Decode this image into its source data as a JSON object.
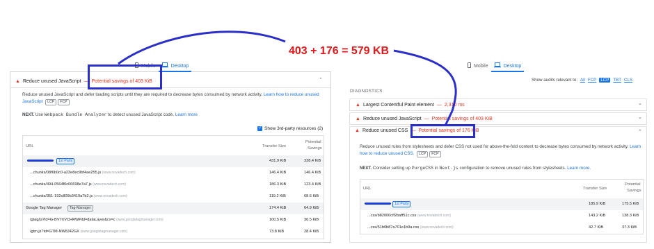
{
  "annotation": {
    "equation": "403 + 176 = 579 KB",
    "stroke_color": "#2b2fc9",
    "text_color": "#e0181b"
  },
  "left_panel": {
    "tabs": [
      {
        "label": "Mobile",
        "icon": "phone-icon"
      },
      {
        "label": "Desktop",
        "icon": "laptop-icon",
        "active": true
      }
    ],
    "audit": {
      "title": "Reduce unused JavaScript",
      "dash": "—",
      "savings": "Potential savings of 403 KiB",
      "description": "Reduce unused JavaScript and defer loading scripts until they are required to decrease bytes consumed by network activity.",
      "learn_link": "Learn how to reduce unused JavaScript",
      "chips": [
        "LCP",
        "FCP"
      ],
      "next_prefix": "Use",
      "next_code": "Webpack Bundle Analyzer",
      "next_suffix": "to detect unused JavaScript code.",
      "next_link": "Learn more",
      "show_3rd_party": "Show 3rd-party resources (2)"
    },
    "table": {
      "headers": {
        "url": "URL",
        "transfer": "Transfer Size",
        "savings_l1": "Potential",
        "savings_l2": "Savings"
      },
      "rows": [
        {
          "label": "",
          "badge": "1st Party",
          "transfer": "431.9 KiB",
          "savings": "338.4 KiB",
          "group": true,
          "redacted": true
        },
        {
          "label": "...chunks/08f6b0c0-a23e8ec9bf4ae255.js",
          "host": "(www.novadech.com)",
          "transfer": "146.4 KiB",
          "savings": "146.4 KiB"
        },
        {
          "label": "...chunks/494-0564f0c06698e7a7.js",
          "host": "(www.novadech.com)",
          "transfer": "186.3 KiB",
          "savings": "123.4 KiB"
        },
        {
          "label": "...chunks/351-192c809b3419a7b2.js",
          "host": "(www.novadech.com)",
          "transfer": "119.2 KiB",
          "savings": "68.6 KiB"
        },
        {
          "label": "Google Tag Manager",
          "badge": "Tag-Manager",
          "transfer": "174.4 KiB",
          "savings": "64.9 KiB",
          "group": true
        },
        {
          "label": "/gtag/js?id=G-BV7XVCHRWP&l=dataLayer&cx=c",
          "host": "(www.googletagmanager.com)",
          "transfer": "100.5 KiB",
          "savings": "36.5 KiB"
        },
        {
          "label": "/gtm.js?id=GTM-NW8J42GX",
          "host": "(www.googletagmanager.com)",
          "transfer": "73.8 KiB",
          "savings": "28.4 KiB"
        }
      ]
    }
  },
  "right_panel": {
    "tabs": [
      {
        "label": "Mobile",
        "icon": "phone-icon"
      },
      {
        "label": "Desktop",
        "icon": "laptop-icon",
        "active": true
      }
    ],
    "audits_relevant_label": "Show audits relevant to:",
    "filters": [
      "All",
      "FCP",
      "LCP",
      "TBT",
      "CLS"
    ],
    "active_filter": "LCP",
    "section": "DIAGNOSTICS",
    "audits": [
      {
        "title": "Largest Contentful Paint element",
        "dash": "—",
        "value": "2,310 ms"
      },
      {
        "title": "Reduce unused JavaScript",
        "dash": "—",
        "value": "Potential savings of 403 KiB"
      },
      {
        "title": "Reduce unused CSS",
        "dash": "—",
        "value": "Potential savings of 176 KiB",
        "expanded": true
      }
    ],
    "css_detail": {
      "description": "Reduce unused rules from stylesheets and defer CSS not used for above-the-fold content to decrease bytes consumed by network activity.",
      "learn_link": "Learn how to reduce unused CSS.",
      "chips": [
        "LCP",
        "FCP"
      ],
      "next_prefix": "Consider setting up",
      "next_code1": "PurgeCSS",
      "next_mid": "in",
      "next_code2": "Next.js",
      "next_suffix": "configuration to remove unused rules from stylesheets.",
      "next_link": "Learn more."
    },
    "table": {
      "headers": {
        "url": "URL",
        "transfer": "Transfer Size",
        "savings_l1": "Potential",
        "savings_l2": "Savings"
      },
      "rows": [
        {
          "label": "",
          "badge": "1st Party",
          "transfer": "185.9 KiB",
          "savings": "175.5 KiB",
          "group": true,
          "redacted": true
        },
        {
          "label": "...css/b82000cff2baff51c.css",
          "host": "(www.novadech.com)",
          "transfer": "143.2 KiB",
          "savings": "138.3 KiB"
        },
        {
          "label": "...css/51b0b87a701e1b9a.css",
          "host": "(www.novadech.com)",
          "transfer": "42.7 KiB",
          "savings": "37.3 KiB"
        }
      ]
    }
  }
}
